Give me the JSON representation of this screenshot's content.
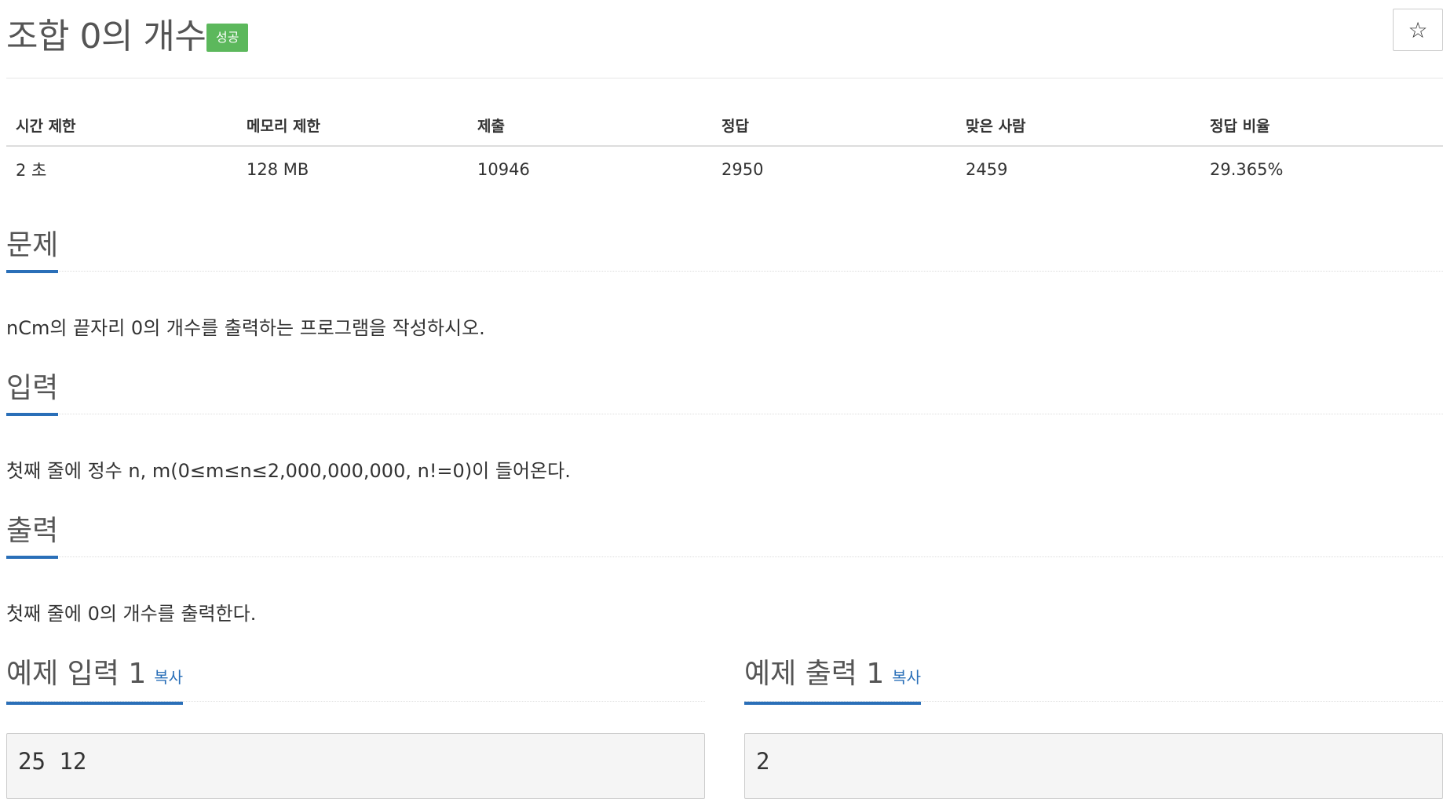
{
  "header": {
    "title": "조합 0의 개수",
    "badge": "성공",
    "star_icon": "☆"
  },
  "info": {
    "columns": [
      "시간 제한",
      "메모리 제한",
      "제출",
      "정답",
      "맞은 사람",
      "정답 비율"
    ],
    "values": [
      "2 초",
      "128 MB",
      "10946",
      "2950",
      "2459",
      "29.365%"
    ]
  },
  "problem": {
    "title": "문제",
    "text": "nCm의 끝자리 0의 개수를 출력하는 프로그램을 작성하시오."
  },
  "input": {
    "title": "입력",
    "text": "첫째 줄에 정수 n, m(0≤m≤n≤2,000,000,000, n!=0)이 들어온다."
  },
  "output": {
    "title": "출력",
    "text": "첫째 줄에 0의 개수를 출력한다."
  },
  "sample_input": {
    "title": "예제 입력 1",
    "copy_label": "복사",
    "content": "25 12"
  },
  "sample_output": {
    "title": "예제 출력 1",
    "copy_label": "복사",
    "content": "2"
  },
  "colors": {
    "accent": "#2a6fb8",
    "success": "#5cb85c"
  }
}
